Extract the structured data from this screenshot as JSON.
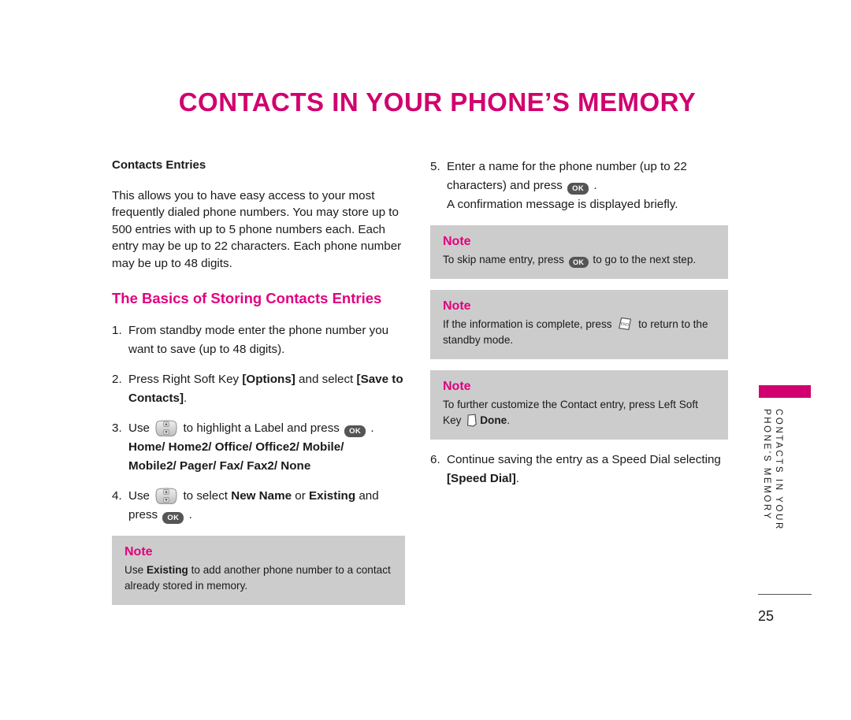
{
  "page": {
    "title": "CONTACTS IN YOUR PHONE’S MEMORY",
    "number": "25",
    "side_tab_line1": "CONTACTS IN YOUR",
    "side_tab_line2": "PHONE'S MEMORY",
    "accent_color": "#d1006e",
    "note_heading_color": "#e3007f",
    "note_background": "#cccccc"
  },
  "left_column": {
    "section_heading": "Contacts Entries",
    "intro_paragraph": "This allows you to have easy access to your most frequently dialed phone numbers. You may store up to 500 entries with up to 5 phone numbers each. Each entry may be up to 22 characters. Each phone number may be up to 48 digits.",
    "sub_heading": "The Basics of Storing Contacts Entries",
    "steps": [
      {
        "number": "1.",
        "text_1": "From standby mode enter the phone number you want to save (up to 48 digits)."
      },
      {
        "number": "2.",
        "text_1": "Press Right Soft Key ",
        "bold_1": "[Options]",
        "text_2": " and select ",
        "bold_2": "[Save to Contacts]",
        "text_3": "."
      },
      {
        "number": "3.",
        "text_1": "Use ",
        "icon_1": "navigation-key-icon",
        "text_2": " to highlight a Label and press ",
        "icon_2": "ok-key-icon",
        "text_3": " .",
        "bold_line_1": "Home/ Home2/ Office/ Office2/ Mobile/",
        "bold_line_2": "Mobile2/ Pager/ Fax/ Fax2/ None"
      },
      {
        "number": "4.",
        "text_1": "Use ",
        "icon_1": "navigation-key-icon",
        "text_2": " to select ",
        "bold_1": "New Name",
        "text_3": " or ",
        "bold_2": "Existing",
        "text_4": " and press ",
        "icon_2": "ok-key-icon",
        "text_5": " ."
      }
    ],
    "note": {
      "title": "Note",
      "text_1": "Use ",
      "bold_1": "Existing",
      "text_2": " to add another phone number to a contact already stored in memory."
    }
  },
  "right_column": {
    "steps": [
      {
        "number": "5.",
        "text_1": "Enter a name for the phone number (up to 22 characters) and press ",
        "icon_1": "ok-key-icon",
        "text_2": " .",
        "text_3": "A confirmation message is displayed briefly."
      },
      {
        "number": "6.",
        "text_1": "Continue saving the entry as a Speed Dial selecting ",
        "bold_1": "[Speed Dial]",
        "text_2": "."
      }
    ],
    "notes": [
      {
        "title": "Note",
        "text_1": "To skip name entry, press ",
        "icon_1": "ok-key-icon",
        "text_2": " to go to the next step."
      },
      {
        "title": "Note",
        "text_1": "If the information is complete, press ",
        "icon_1": "end-key-icon",
        "text_2": " to return to the standby mode."
      },
      {
        "title": "Note",
        "text_1": "To further customize the Contact entry, press Left Soft Key ",
        "icon_1": "left-soft-key-icon",
        "bold_1": "Done",
        "text_2": "."
      }
    ]
  }
}
